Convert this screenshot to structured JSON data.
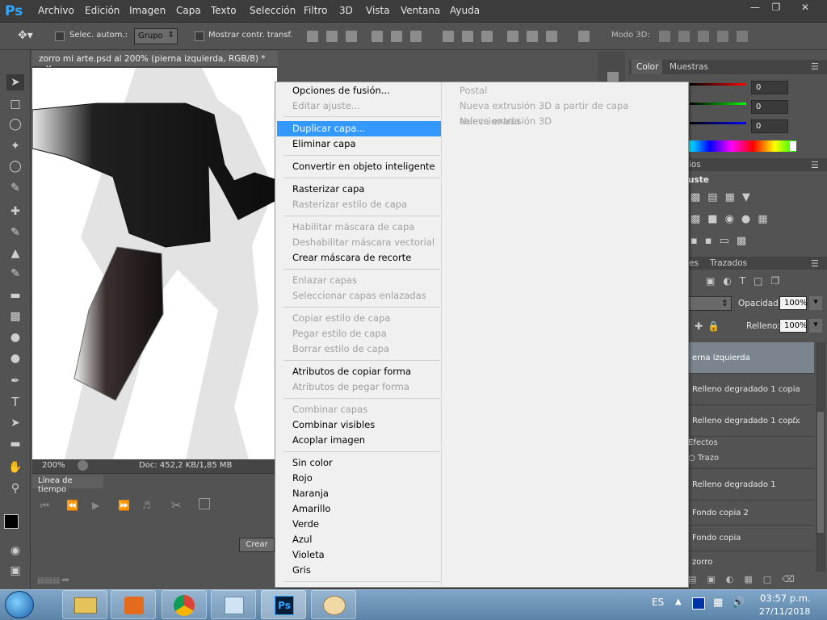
{
  "app": {
    "logo": "Ps"
  },
  "menubar": [
    "Archivo",
    "Edición",
    "Imagen",
    "Capa",
    "Texto",
    "Selección",
    "Filtro",
    "3D",
    "Vista",
    "Ventana",
    "Ayuda"
  ],
  "options": {
    "auto_select": "Selec. autom.:",
    "group_value": "Grupo",
    "show_transform": "Mostrar contr. transf.",
    "mode3d": "Modo 3D:"
  },
  "document": {
    "tab_title": "zorro mi arte.psd al 200% (pierna izquierda, RGB/8) *",
    "zoom": "200%",
    "doc_info": "Doc: 452,2 KB/1,85 MB"
  },
  "timeline": {
    "tab": "Línea de tiempo",
    "create": "Crear"
  },
  "right_panel": {
    "tab_color": "Color",
    "tab_swatches": "Muestras",
    "r": "0",
    "g": "0",
    "b": "0",
    "adjust_tab_partial": "ios",
    "adjust_title_partial": "uste",
    "layers_tab_partial": "es",
    "paths_tab": "Trazados",
    "opacity_label": "Opacidad:",
    "opacity_value": "100%",
    "fill_label": "Relleno:",
    "fill_value": "100%",
    "layers": [
      "erna izquierda",
      "Relleno degradado 1 copia",
      "Relleno degradado 1 cop...",
      "Efectos",
      "Trazo",
      "Relleno degradado 1",
      "Fondo copia 2",
      "Fondo copia",
      "zorro"
    ]
  },
  "context_menu": {
    "left": [
      {
        "label": "Opciones de fusión...",
        "disabled": false
      },
      {
        "label": "Editar ajuste...",
        "disabled": true
      },
      {
        "label": "Duplicar capa...",
        "disabled": false,
        "highlighted": true
      },
      {
        "label": "Eliminar capa",
        "disabled": false
      },
      {
        "label": "Convertir en objeto inteligente",
        "disabled": false
      },
      {
        "label": "Rasterizar capa",
        "disabled": false
      },
      {
        "label": "Rasterizar estilo de capa",
        "disabled": true
      },
      {
        "label": "Habilitar máscara de capa",
        "disabled": true
      },
      {
        "label": "Deshabilitar máscara vectorial",
        "disabled": true
      },
      {
        "label": "Crear máscara de recorte",
        "disabled": false
      },
      {
        "label": "Enlazar capas",
        "disabled": true
      },
      {
        "label": "Seleccionar capas enlazadas",
        "disabled": true
      },
      {
        "label": "Copiar estilo de capa",
        "disabled": true
      },
      {
        "label": "Pegar estilo de capa",
        "disabled": true
      },
      {
        "label": "Borrar estilo de capa",
        "disabled": true
      },
      {
        "label": "Atributos de copiar forma",
        "disabled": false
      },
      {
        "label": "Atributos de pegar forma",
        "disabled": true
      },
      {
        "label": "Combinar capas",
        "disabled": true
      },
      {
        "label": "Combinar visibles",
        "disabled": false
      },
      {
        "label": "Acoplar imagen",
        "disabled": false
      },
      {
        "label": "Sin color",
        "disabled": false
      },
      {
        "label": "Rojo",
        "disabled": false
      },
      {
        "label": "Naranja",
        "disabled": false
      },
      {
        "label": "Amarillo",
        "disabled": false
      },
      {
        "label": "Verde",
        "disabled": false
      },
      {
        "label": "Azul",
        "disabled": false
      },
      {
        "label": "Violeta",
        "disabled": false
      },
      {
        "label": "Gris",
        "disabled": false
      }
    ],
    "right": [
      {
        "label": "Postal",
        "disabled": true
      },
      {
        "label": "Nueva extrusión 3D a partir de capa seleccionada",
        "disabled": true
      },
      {
        "label": "Nueva extrusión 3D",
        "disabled": true
      }
    ]
  },
  "taskbar": {
    "lang": "ES",
    "time": "03:57 p.m.",
    "date": "27/11/2018"
  }
}
